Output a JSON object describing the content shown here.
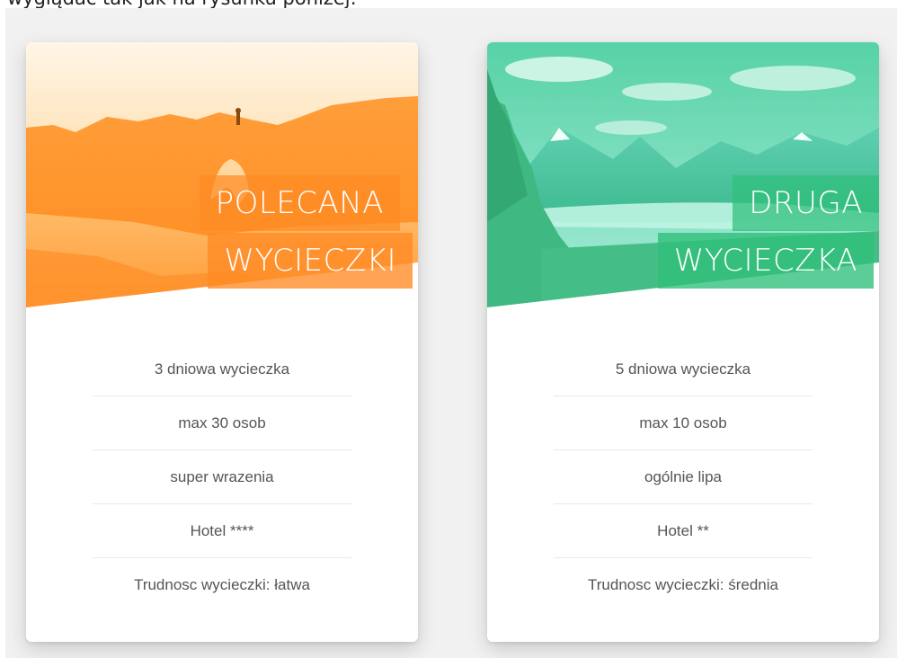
{
  "caption": "wyglądać tak jak na rysunku poniżej:",
  "cards": [
    {
      "title_line1": "POLECANA",
      "title_line2": "WYCIECZKI",
      "theme": "orange",
      "accent_color": "#ff8a24",
      "features": [
        "3 dniowa wycieczka",
        "max 30 osob",
        "super wrazenia",
        "Hotel ****",
        "Trudnosc wycieczki: łatwa"
      ]
    },
    {
      "title_line1": "DRUGA",
      "title_line2": "WYCIECZKA",
      "theme": "green",
      "accent_color": "#2fbf7a",
      "features": [
        "5 dniowa wycieczka",
        "max 10 osob",
        "ogólnie lipa",
        "Hotel **",
        "Trudnosc wycieczki: średnia"
      ]
    }
  ]
}
